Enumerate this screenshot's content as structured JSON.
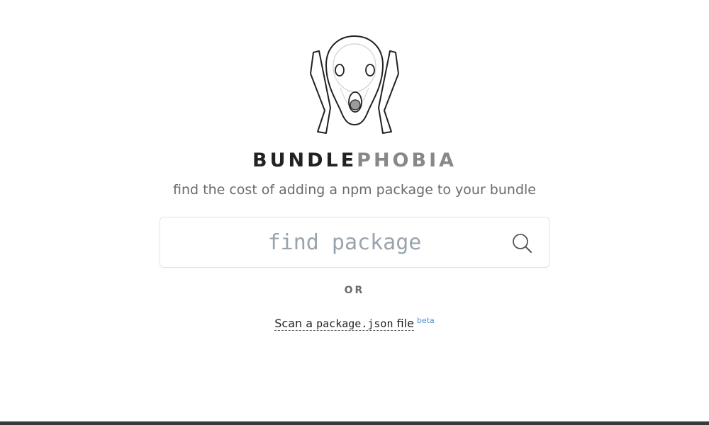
{
  "brand": {
    "name_dark": "BUNDLE",
    "name_light": "PHOBIA",
    "tagline": "find the cost of adding a npm package to your bundle"
  },
  "search": {
    "placeholder": "find package",
    "icon": "search-icon"
  },
  "divider": {
    "label": "OR"
  },
  "scan": {
    "prefix": "Scan a ",
    "code": "package.json",
    "suffix": " file",
    "badge": "beta"
  },
  "colors": {
    "brand_dark": "#222222",
    "brand_light": "#888888",
    "tagline": "#6b6b6b",
    "placeholder": "#9aa4ad",
    "beta": "#4a90d9",
    "footer": "#3a3a3a"
  }
}
